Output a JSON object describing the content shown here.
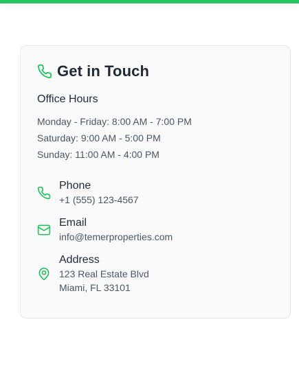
{
  "accent_color": "#22c55e",
  "card": {
    "title": "Get in Touch",
    "title_icon": "phone-icon",
    "hours": {
      "title": "Office Hours",
      "lines": [
        "Monday - Friday: 8:00 AM - 7:00 PM",
        "Saturday: 9:00 AM - 5:00 PM",
        "Sunday: 11:00 AM - 4:00 PM"
      ]
    },
    "contacts": [
      {
        "icon": "phone-icon",
        "label": "Phone",
        "value": "+1 (555) 123-4567"
      },
      {
        "icon": "mail-icon",
        "label": "Email",
        "value": "info@temerproperties.com"
      },
      {
        "icon": "map-pin-icon",
        "label": "Address",
        "value_line1": "123 Real Estate Blvd",
        "value_line2": "Miami, FL 33101"
      }
    ]
  }
}
